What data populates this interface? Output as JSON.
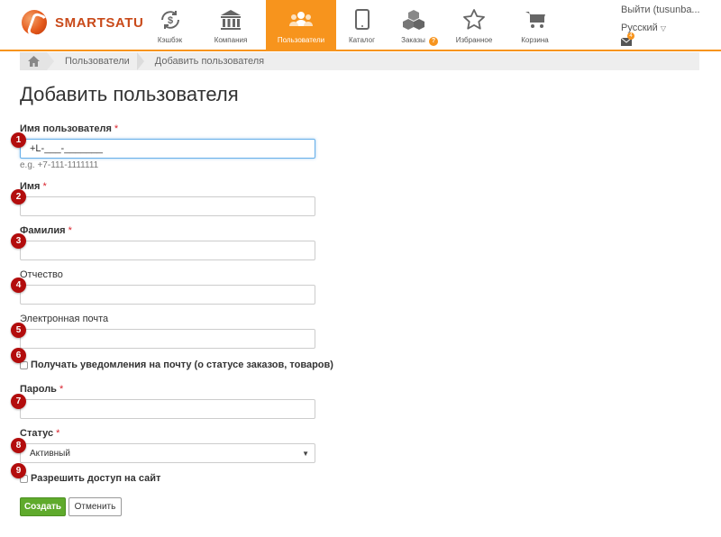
{
  "header": {
    "brand": "SMARTSATU",
    "nav": [
      {
        "label": "Кэшбэк",
        "icon": "dollar-cycle-icon"
      },
      {
        "label": "Компания",
        "icon": "bank-icon"
      },
      {
        "label": "Пользователи",
        "icon": "users-icon",
        "active": true
      },
      {
        "label": "Каталог",
        "icon": "tablet-icon"
      },
      {
        "label": "Заказы",
        "icon": "boxes-icon",
        "badge": "?"
      },
      {
        "label": "Избранное",
        "icon": "star-icon"
      },
      {
        "label": "Корзина",
        "icon": "cart-icon"
      }
    ],
    "user": {
      "logout": "Выйти (tusunba...",
      "language": "Русский",
      "mail_badge": "4"
    }
  },
  "breadcrumb": {
    "items": [
      "Пользователи",
      "Добавить пользователя"
    ]
  },
  "form": {
    "title": "Добавить пользователя",
    "required_mark": "*",
    "fields": {
      "username": {
        "label": "Имя пользователя",
        "value": "+L-___-_______",
        "hint": "e.g. +7-111-1111111",
        "badge": "1"
      },
      "first_name": {
        "label": "Имя",
        "value": "",
        "badge": "2"
      },
      "last_name": {
        "label": "Фамилия",
        "value": "",
        "badge": "3"
      },
      "middle_name": {
        "label": "Отчество",
        "value": "",
        "badge": "4"
      },
      "email": {
        "label": "Электронная почта",
        "value": "",
        "badge": "5"
      },
      "notify": {
        "label": "Получать уведомления на почту (о статусе заказов, товаров)",
        "badge": "6"
      },
      "password": {
        "label": "Пароль",
        "value": "",
        "badge": "7"
      },
      "status": {
        "label": "Статус",
        "value": "Активный",
        "badge": "8"
      },
      "site_access": {
        "label": "Разрешить доступ на сайт",
        "badge": "9"
      }
    },
    "buttons": {
      "create": "Создать",
      "cancel": "Отменить"
    }
  },
  "colors": {
    "accent": "#f7941d",
    "badge": "#b30d0d",
    "create_button": "#5faa2c",
    "required": "#d9232d"
  }
}
